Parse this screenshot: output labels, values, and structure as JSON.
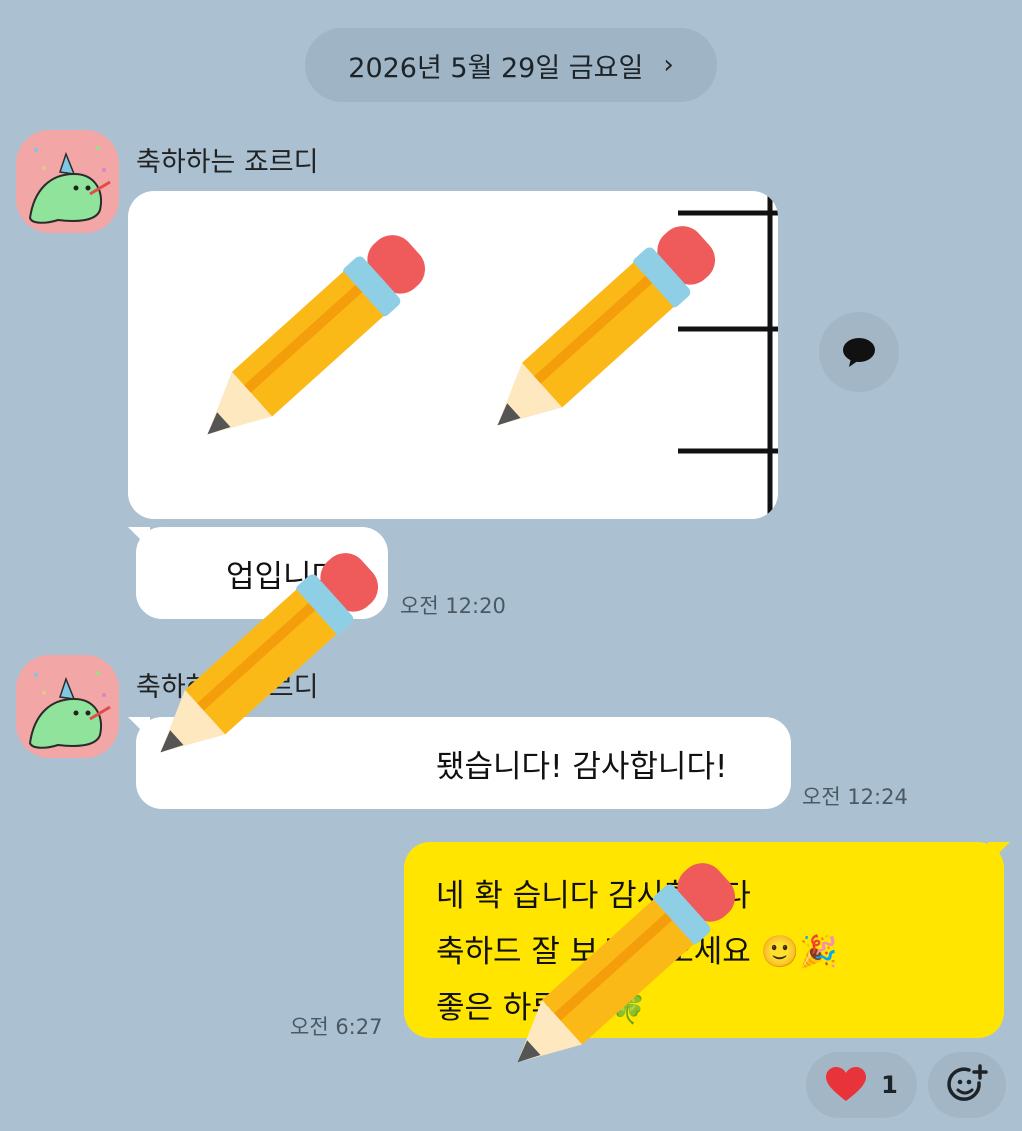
{
  "date_header": {
    "label": "2026년 5월 29일 금요일",
    "chevron": "›"
  },
  "messages": [
    {
      "sender": "축하하는 죠르디",
      "text": "업입니다!",
      "time": "오전 12:20"
    },
    {
      "sender": "축하하는 죠르디",
      "text": "됐습니다! 감사합니다!",
      "time": "오전 12:24"
    }
  ],
  "my_message": {
    "lines": [
      "네 확 습니다 감사합니다",
      "축하드 잘 보시고 오세요 🙂🎉",
      "좋은 하루 요 🍀"
    ],
    "time": "오전 6:27",
    "bubble_color": "#ffe500"
  },
  "reaction": {
    "icon": "heart-icon",
    "count": "1",
    "color": "#e8333b"
  },
  "icons": {
    "share": "speech-bubble-icon",
    "add_reaction": "smiley-plus-icon",
    "avatar": "jordy-dinosaur-icon"
  },
  "colors": {
    "background": "#abc1d1",
    "bubble": "#ffffff"
  }
}
